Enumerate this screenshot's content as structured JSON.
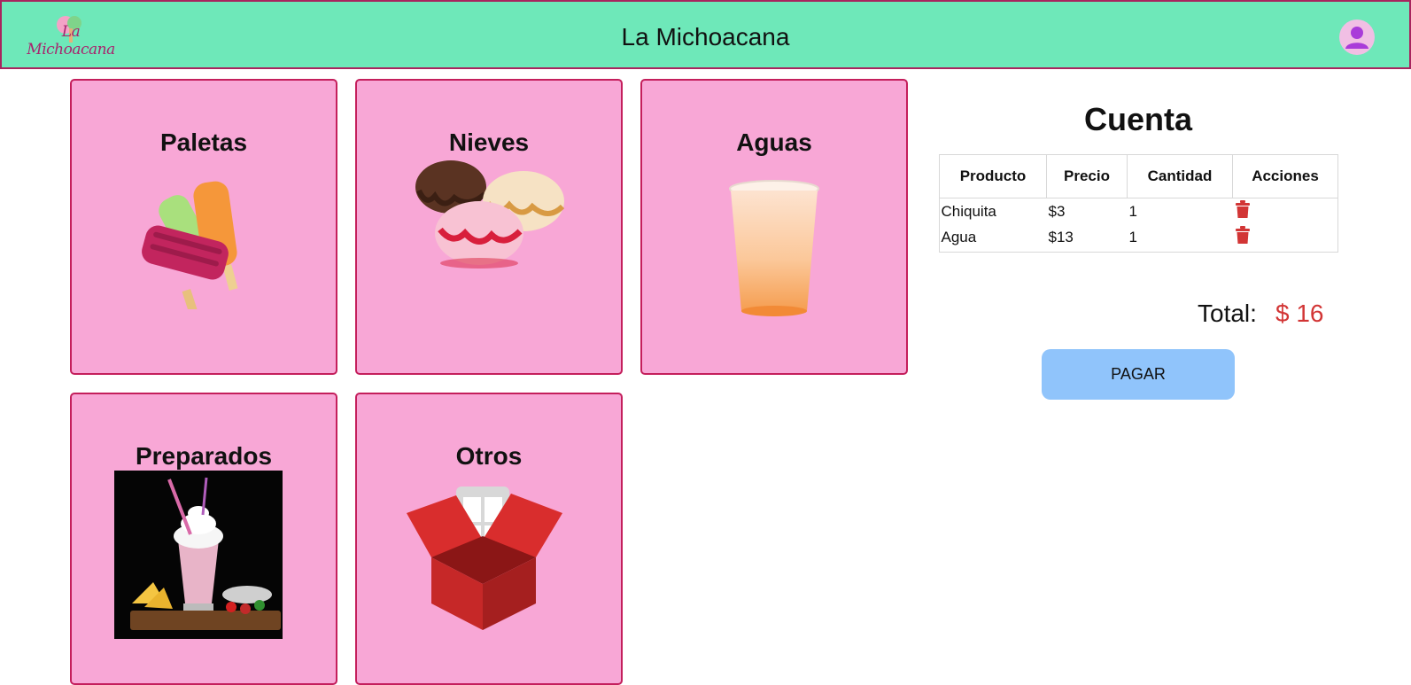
{
  "header": {
    "logo_text": "La Michoacana",
    "title": "La Michoacana"
  },
  "categories": [
    {
      "label": "Paletas",
      "icon": "popsicles-image"
    },
    {
      "label": "Nieves",
      "icon": "ice-cream-scoops-image"
    },
    {
      "label": "Aguas",
      "icon": "agua-cup-image"
    },
    {
      "label": "Preparados",
      "icon": "milkshake-image"
    },
    {
      "label": "Otros",
      "icon": "box-image"
    }
  ],
  "cuenta": {
    "title": "Cuenta",
    "headers": [
      "Producto",
      "Precio",
      "Cantidad",
      "Acciones"
    ],
    "rows": [
      {
        "producto": "Chiquita",
        "precio": "$3",
        "cantidad": "1"
      },
      {
        "producto": "Agua",
        "precio": "$13",
        "cantidad": "1"
      }
    ],
    "total_label": "Total:",
    "total_value": "$ 16",
    "pay_label": "PAGAR"
  },
  "colors": {
    "header_bg": "#6ee8b9",
    "card_bg": "#f8a7d6",
    "card_border": "#c41f5c",
    "total_color": "#d23535",
    "pay_bg": "#90c4fb"
  }
}
